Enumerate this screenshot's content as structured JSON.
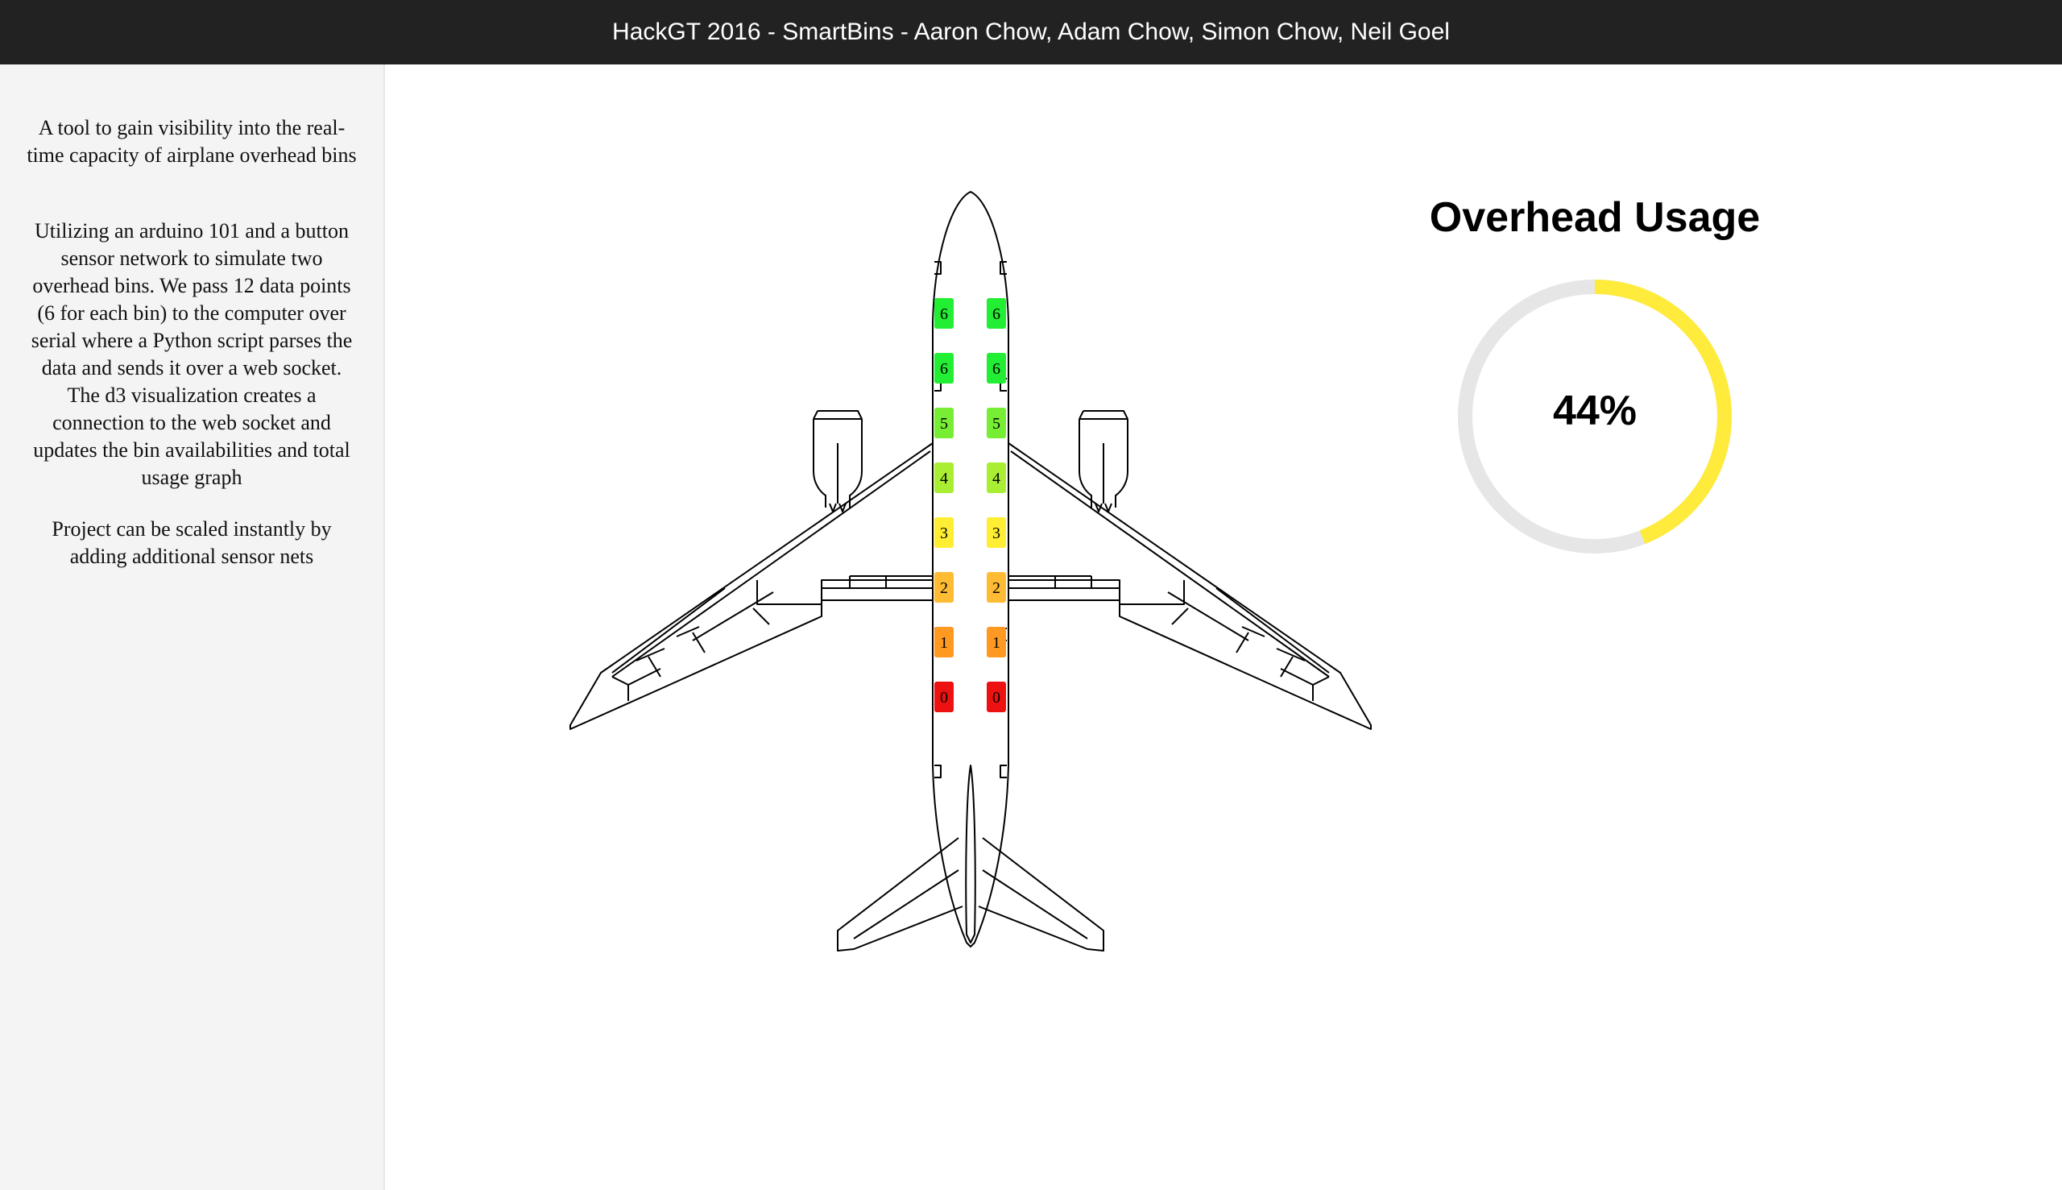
{
  "header": {
    "title": "HackGT 2016 - SmartBins - Aaron Chow, Adam Chow, Simon Chow, Neil Goel"
  },
  "sidebar": {
    "paragraph_1": "A tool to gain visibility into the real-time capacity of airplane overhead bins",
    "paragraph_2": "Utilizing an arduino 101 and a button sensor network to simulate two overhead bins. We pass 12 data points (6 for each bin) to the computer over serial where a Python script parses the data and sends it over a web socket. The d3 visualization creates a connection to the web socket and updates the bin availabilities and total usage graph",
    "paragraph_3": "Project can be scaled instantly by adding additional sensor nets"
  },
  "plane": {
    "left_bins": [
      "6",
      "6",
      "5",
      "4",
      "3",
      "2",
      "1",
      "0"
    ],
    "right_bins": [
      "6",
      "6",
      "5",
      "4",
      "3",
      "2",
      "1",
      "0"
    ],
    "bin_colors": {
      "6": "#22ee33",
      "5": "#77ee33",
      "4": "#aaee33",
      "3": "#ffee33",
      "2": "#ffbb33",
      "1": "#ff9922",
      "0": "#ee1111"
    }
  },
  "usage": {
    "title": "Overhead Usage",
    "percent_label": "44%",
    "fraction": 0.44,
    "fill_color": "#ffeb3b",
    "track_color": "#e6e6e6"
  }
}
